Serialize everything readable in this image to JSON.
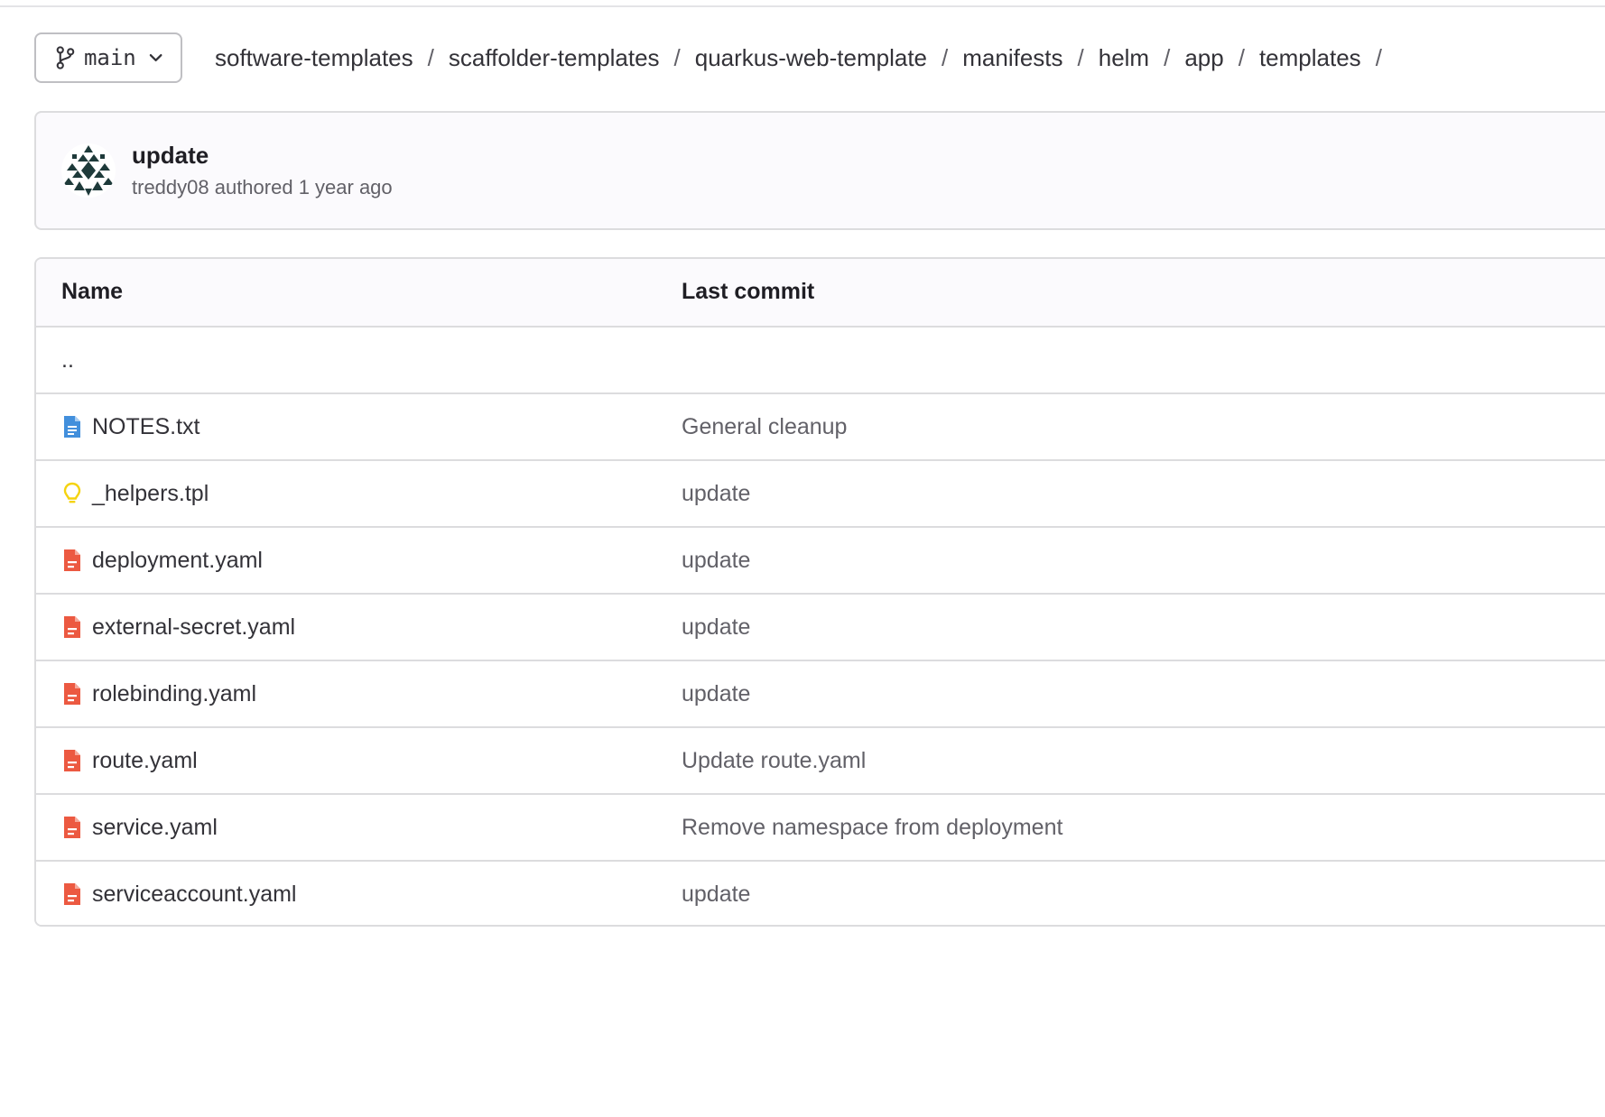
{
  "branch": {
    "name": "main",
    "branch_icon": "branch-icon",
    "dropdown_icon": "chevron-down-icon"
  },
  "breadcrumb": [
    "software-templates",
    "scaffolder-templates",
    "quarkus-web-template",
    "manifests",
    "helm",
    "app",
    "templates"
  ],
  "breadcrumb_separator": "/",
  "last_commit": {
    "title": "update",
    "author_line": "treddy08 authored 1 year ago"
  },
  "table": {
    "headers": {
      "name": "Name",
      "last_commit": "Last commit"
    },
    "parent": "..",
    "files": [
      {
        "name": "NOTES.txt",
        "commit": "General cleanup",
        "icon": "text-file-icon",
        "color": "#428fdc"
      },
      {
        "name": "_helpers.tpl",
        "commit": "update",
        "icon": "lightbulb-icon",
        "color": "#f5d30f"
      },
      {
        "name": "deployment.yaml",
        "commit": "update",
        "icon": "yaml-file-icon",
        "color": "#ec5941"
      },
      {
        "name": "external-secret.yaml",
        "commit": "update",
        "icon": "yaml-file-icon",
        "color": "#ec5941"
      },
      {
        "name": "rolebinding.yaml",
        "commit": "update",
        "icon": "yaml-file-icon",
        "color": "#ec5941"
      },
      {
        "name": "route.yaml",
        "commit": "Update route.yaml",
        "icon": "yaml-file-icon",
        "color": "#ec5941"
      },
      {
        "name": "service.yaml",
        "commit": "Remove namespace from deployment",
        "icon": "yaml-file-icon",
        "color": "#ec5941"
      },
      {
        "name": "serviceaccount.yaml",
        "commit": "update",
        "icon": "yaml-file-icon",
        "color": "#ec5941"
      }
    ]
  }
}
